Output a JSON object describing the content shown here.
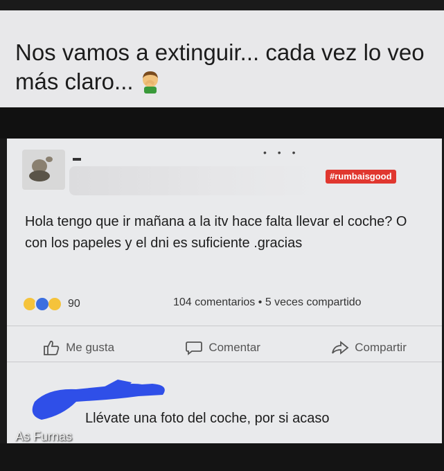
{
  "caption": {
    "text": "Nos vamos a extinguir... cada vez lo veo más claro...",
    "emoji": "facepalm-emoji"
  },
  "post": {
    "hashtag": "#rumbaisgood",
    "body": "Hola tengo que ir mañana  a la  itv hace falta llevar el coche? O con los papeles y el dni es suficiente .gracias",
    "reactions": {
      "icons": [
        "haha-icon",
        "like-icon",
        "wow-icon"
      ],
      "count": "90"
    },
    "stats": {
      "comments": "104 comentarios",
      "separator": "•",
      "shares": "5 veces compartido"
    },
    "actions": {
      "like_label": "Me gusta",
      "comment_label": "Comentar",
      "share_label": "Compartir"
    },
    "comment": {
      "text": "Llévate una foto del coche, por si acaso"
    }
  },
  "watermark": "As Furnas",
  "colors": {
    "hashtag_bg": "#e0372f",
    "scribble": "#2f4fe8",
    "post_bg": "#e9eaec"
  }
}
